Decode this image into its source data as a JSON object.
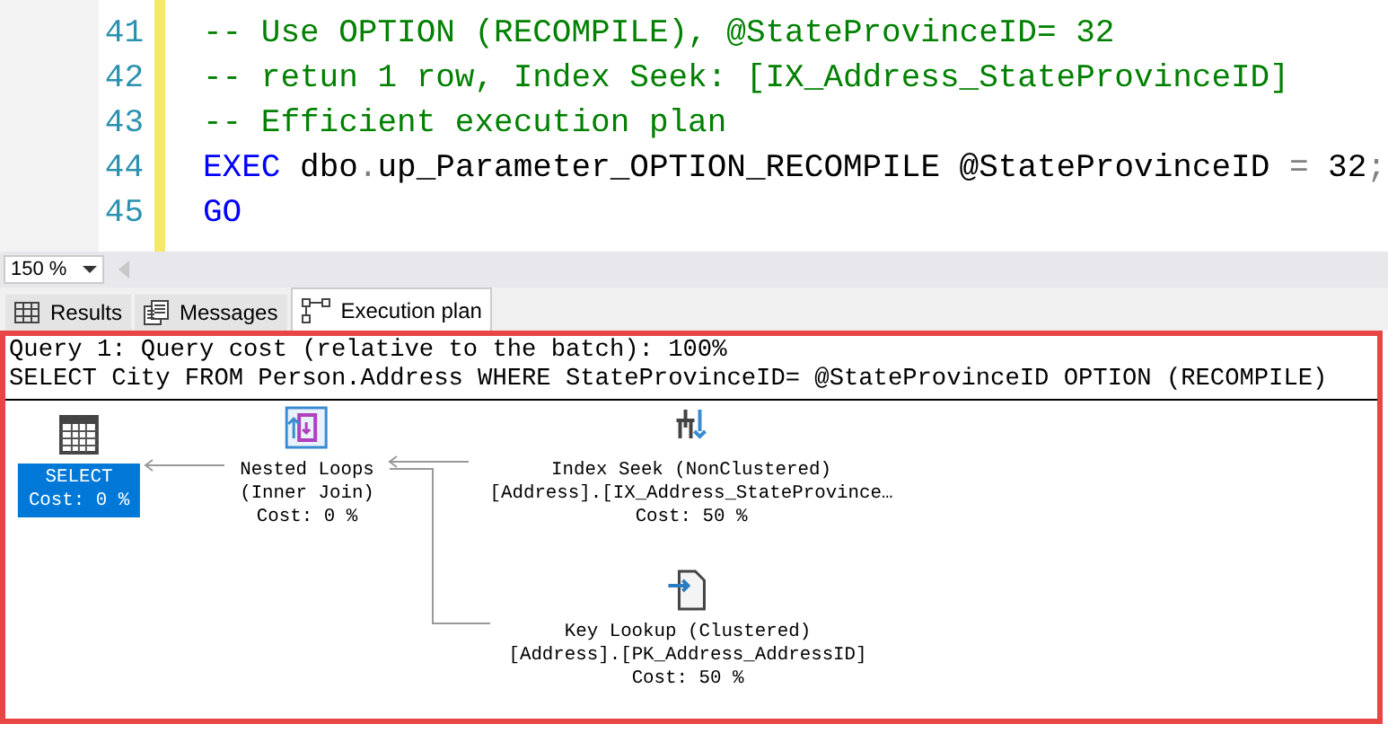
{
  "editor": {
    "lines": [
      {
        "number": "41",
        "tokens": [
          {
            "kind": "comment",
            "text": "-- Use OPTION (RECOMPILE), @StateProvinceID= 32"
          }
        ]
      },
      {
        "number": "42",
        "tokens": [
          {
            "kind": "comment",
            "text": "-- retun 1 row, Index Seek: [IX_Address_StateProvinceID]"
          }
        ]
      },
      {
        "number": "43",
        "tokens": [
          {
            "kind": "comment",
            "text": "-- Efficient execution plan"
          }
        ]
      },
      {
        "number": "44",
        "tokens": [
          {
            "kind": "keyword",
            "text": "EXEC"
          },
          {
            "kind": "plain",
            "text": " dbo"
          },
          {
            "kind": "operator",
            "text": "."
          },
          {
            "kind": "plain",
            "text": "up_Parameter_OPTION_RECOMPILE @StateProvinceID "
          },
          {
            "kind": "operator",
            "text": "="
          },
          {
            "kind": "plain",
            "text": " 32"
          },
          {
            "kind": "operator",
            "text": ";"
          }
        ]
      },
      {
        "number": "45",
        "tokens": [
          {
            "kind": "keyword",
            "text": "GO"
          }
        ]
      }
    ]
  },
  "zoom": {
    "value": "150 %"
  },
  "tabs": [
    {
      "label": "Results",
      "kind": "grid",
      "selected": false
    },
    {
      "label": "Messages",
      "kind": "messages",
      "selected": false
    },
    {
      "label": "Execution plan",
      "kind": "plan",
      "selected": true
    }
  ],
  "plan": {
    "header": [
      "Query 1: Query cost (relative to the batch): 100%",
      "SELECT City FROM Person.Address WHERE StateProvinceID= @StateProvinceID OPTION (RECOMPILE)"
    ],
    "nodes": [
      {
        "kind": "select",
        "selected": true,
        "lines": [
          "SELECT",
          "Cost: 0 %"
        ]
      },
      {
        "kind": "nested-loops",
        "selected": false,
        "lines": [
          "Nested Loops",
          "(Inner Join)",
          "Cost: 0 %"
        ]
      },
      {
        "kind": "index-seek",
        "selected": false,
        "lines": [
          "Index Seek (NonClustered)",
          "[Address].[IX_Address_StateProvince…",
          "Cost: 50 %"
        ]
      },
      {
        "kind": "key-lookup",
        "selected": false,
        "lines": [
          "Key Lookup (Clustered)",
          "[Address].[PK_Address_AddressID]",
          "Cost: 50 %"
        ]
      }
    ]
  }
}
